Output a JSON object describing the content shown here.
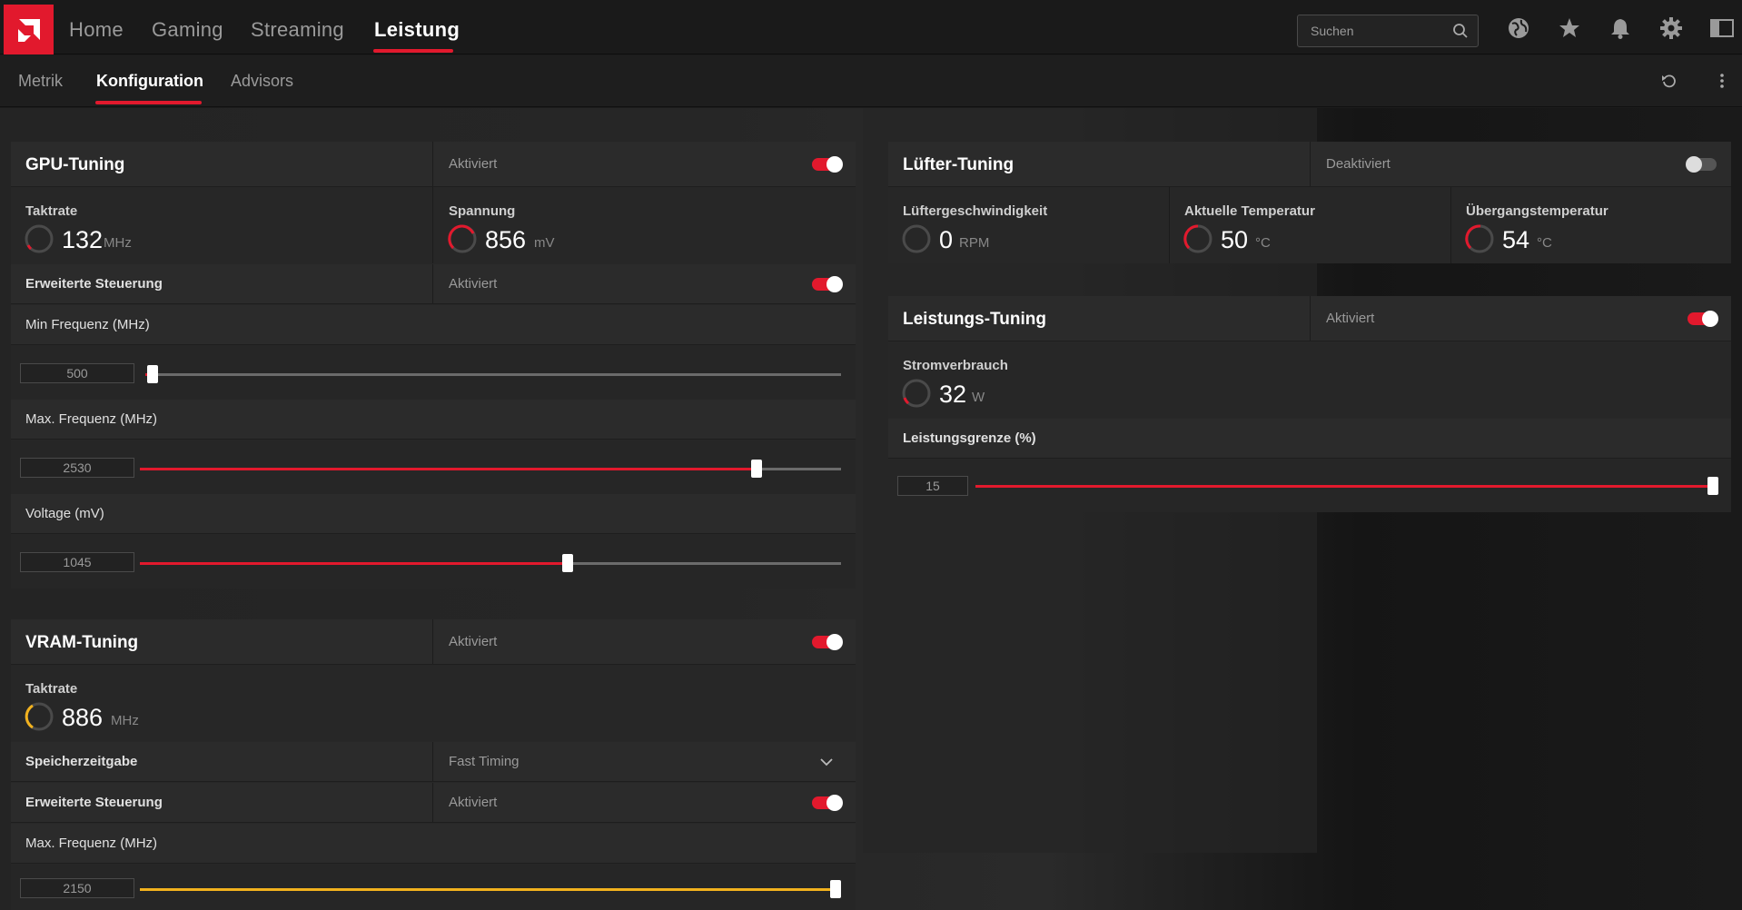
{
  "nav": {
    "tabs": [
      "Home",
      "Gaming",
      "Streaming",
      "Leistung"
    ],
    "active": "Leistung"
  },
  "search": {
    "placeholder": "Suchen"
  },
  "subnav": {
    "tabs": [
      "Metrik",
      "Konfiguration",
      "Advisors"
    ],
    "active": "Konfiguration"
  },
  "icons": [
    "amd-logo-icon",
    "search-icon",
    "globe-icon",
    "star-icon",
    "bell-icon",
    "gear-icon",
    "sidebar-icon",
    "reset-icon",
    "more-vert-icon",
    "chevron-down-icon"
  ],
  "colors": {
    "accent": "#e2192d",
    "vram_accent": "#f2b21e",
    "background": "#1c1c1c",
    "panel": "#282828"
  },
  "gpu": {
    "title": "GPU-Tuning",
    "status": "Aktiviert",
    "enabled": true,
    "clock": {
      "label": "Taktrate",
      "value": "132",
      "unit": "MHz"
    },
    "voltage": {
      "label": "Spannung",
      "value": "856",
      "unit": "mV"
    },
    "advanced": {
      "label": "Erweiterte Steuerung",
      "status": "Aktiviert",
      "enabled": true
    },
    "min_freq": {
      "label": "Min Frequenz (MHz)",
      "value": "500",
      "level": 0.01
    },
    "max_freq": {
      "label": "Max. Frequenz (MHz)",
      "value": "2530",
      "level": 0.88
    },
    "voltage_slider": {
      "label": "Voltage (mV)",
      "value": "1045",
      "level": 0.61
    }
  },
  "vram": {
    "title": "VRAM-Tuning",
    "status": "Aktiviert",
    "enabled": true,
    "clock": {
      "label": "Taktrate",
      "value": "886",
      "unit": "MHz"
    },
    "timing": {
      "label": "Speicherzeitgabe",
      "value": "Fast Timing"
    },
    "advanced": {
      "label": "Erweiterte Steuerung",
      "status": "Aktiviert",
      "enabled": true
    },
    "max_freq": {
      "label": "Max. Frequenz (MHz)",
      "value": "2150",
      "level": 1.0
    }
  },
  "fan": {
    "title": "Lüfter-Tuning",
    "status": "Deaktiviert",
    "enabled": false,
    "speed": {
      "label": "Lüftergeschwindigkeit",
      "value": "0",
      "unit": "RPM"
    },
    "temp": {
      "label": "Aktuelle Temperatur",
      "value": "50",
      "unit": "°C"
    },
    "junction": {
      "label": "Übergangstemperatur",
      "value": "54",
      "unit": "°C"
    }
  },
  "power": {
    "title": "Leistungs-Tuning",
    "status": "Aktiviert",
    "enabled": true,
    "consumption": {
      "label": "Stromverbrauch",
      "value": "32",
      "unit": "W"
    },
    "limit": {
      "label": "Leistungsgrenze (%)",
      "value": "15",
      "level": 1.0
    }
  }
}
